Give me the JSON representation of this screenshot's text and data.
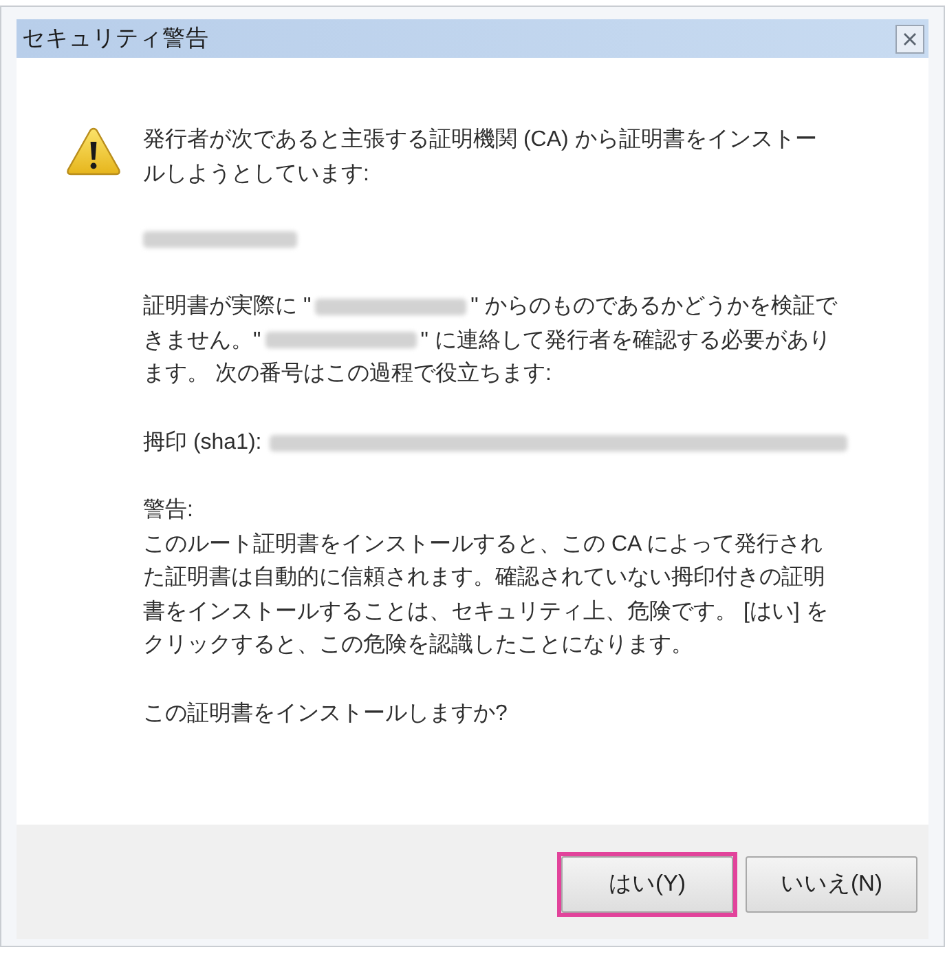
{
  "window": {
    "title": "セキュリティ警告"
  },
  "message": {
    "intro": "発行者が次であると主張する証明機関 (CA) から証明書をインストールしようとしています:",
    "issuer": {
      "kind": "redacted"
    },
    "verification": [
      {
        "kind": "text",
        "text": "証明書が実際に \""
      },
      {
        "kind": "redacted"
      },
      {
        "kind": "text",
        "text": "\" からのものであるかどうかを検証できません。\""
      },
      {
        "kind": "redacted"
      },
      {
        "kind": "text",
        "text": "\" に連絡して発行者を確認する必要があります。 次の番号はこの過程で役立ちます:"
      }
    ],
    "thumbprint": {
      "label": "拇印 (sha1):",
      "value": {
        "kind": "redacted"
      }
    },
    "warning": {
      "heading": "警告:",
      "text": "このルート証明書をインストールすると、この CA によって発行された証明書は自動的に信頼されます。確認されていない拇印付きの証明書をインストールすることは、セキュリティ上、危険です。 [はい] をクリックすると、この危険を認識したことになります。"
    },
    "question": "この証明書をインストールしますか?"
  },
  "buttons": [
    {
      "label": "はい(Y)",
      "highlighted": true
    },
    {
      "label": "いいえ(N)",
      "highlighted": false
    }
  ]
}
